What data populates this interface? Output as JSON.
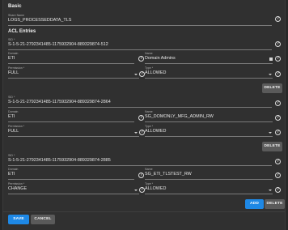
{
  "basic": {
    "title": "Basic",
    "share_name_label": "Share Name",
    "share_name_value": "LOGS_PROCESSEDDATA_TLS"
  },
  "acl": {
    "title": "ACL Entries",
    "entries": [
      {
        "sid_label": "SID *",
        "sid_value": "S-1-5-21-2792341485-1175932904-889329874-512",
        "domain_label": "Domain",
        "domain_value": "ETI",
        "name_label": "Name",
        "name_value": "Domain Admins",
        "permission_label": "Permission *",
        "permission_value": "FULL",
        "type_label": "Type *",
        "type_value": "ALLOWED",
        "delete_label": "DELETE"
      },
      {
        "sid_label": "SID *",
        "sid_value": "S-1-5-21-2792341485-1175932904-889329874-2864",
        "domain_label": "Domain",
        "domain_value": "ETI",
        "name_label": "Name",
        "name_value": "SG_DOMONLY_MFG_ADMIN_RW",
        "permission_label": "Permission *",
        "permission_value": "FULL",
        "type_label": "Type *",
        "type_value": "ALLOWED",
        "delete_label": "DELETE"
      },
      {
        "sid_label": "SID *",
        "sid_value": "S-1-5-21-2792341485-1175932904-889329874-2885",
        "domain_label": "Domain",
        "domain_value": "ETI",
        "name_label": "Name",
        "name_value": "SG_ETI_TLSTEST_RW",
        "permission_label": "Permission *",
        "permission_value": "CHANGE",
        "type_label": "Type *",
        "type_value": "ALLOWED",
        "delete_label": "DELETE"
      }
    ],
    "add_label": "ADD"
  },
  "footer": {
    "save_label": "SAVE",
    "cancel_label": "CANCEL"
  },
  "colors": {
    "background": "#303030",
    "primary_button": "#1e88e5",
    "secondary_button": "#5a5a5a"
  },
  "icons": {
    "help": "help-circle-icon",
    "dropdown": "caret-down-icon",
    "name_square": "square-icon"
  }
}
